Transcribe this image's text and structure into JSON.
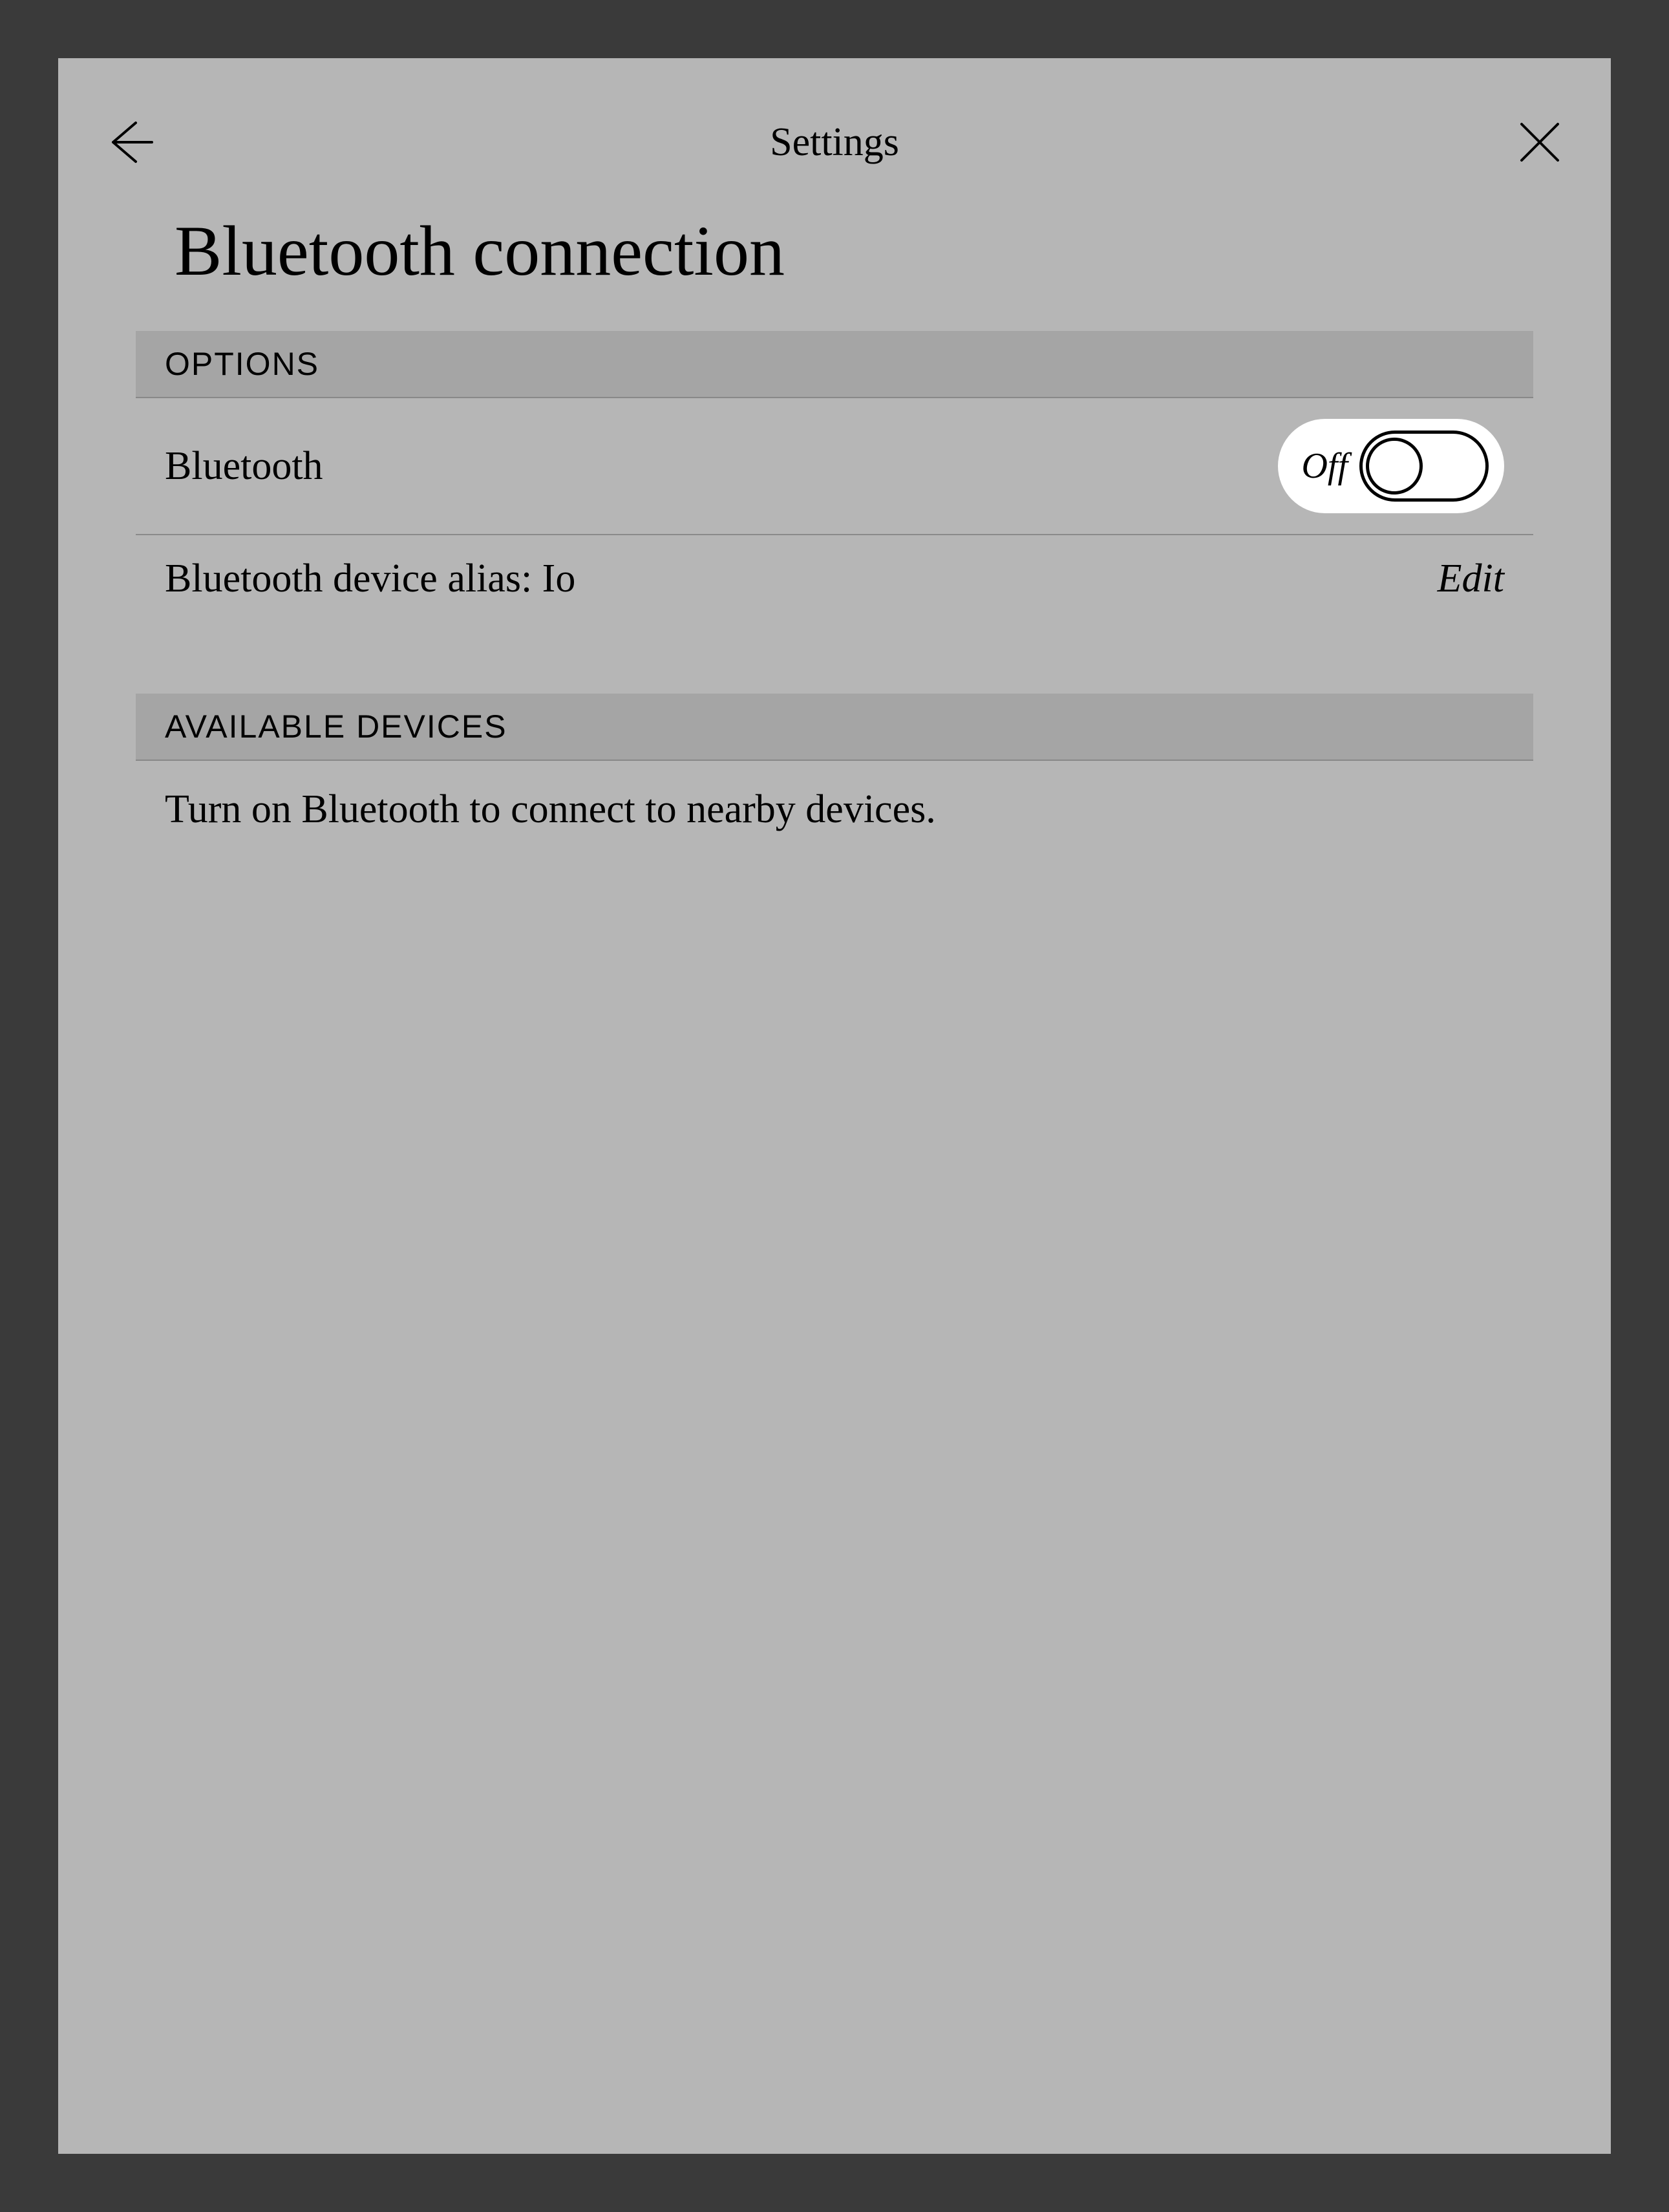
{
  "header": {
    "title": "Settings"
  },
  "page": {
    "title": "Bluetooth connection"
  },
  "sections": {
    "options": {
      "header": "OPTIONS",
      "bluetooth": {
        "label": "Bluetooth",
        "toggle_state": "Off"
      },
      "alias": {
        "label": "Bluetooth device alias: Io",
        "action": "Edit"
      }
    },
    "devices": {
      "header": "AVAILABLE DEVICES",
      "hint": "Turn on Bluetooth to connect to nearby devices."
    }
  }
}
